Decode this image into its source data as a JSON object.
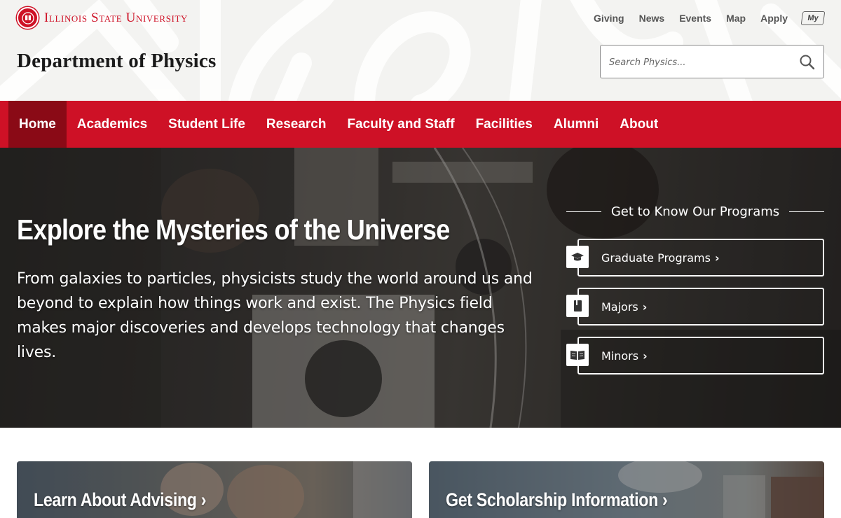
{
  "brand": {
    "university": "Illinois State University",
    "department": "Department of Physics",
    "accent_color": "#ce1126",
    "seal_icon": "redbird-seal-icon"
  },
  "utility_nav": [
    {
      "label": "Giving"
    },
    {
      "label": "News"
    },
    {
      "label": "Events"
    },
    {
      "label": "Map"
    },
    {
      "label": "Apply"
    }
  ],
  "my_badge": "My",
  "search": {
    "placeholder": "Search Physics...",
    "icon": "search-icon"
  },
  "main_nav": [
    {
      "label": "Home",
      "active": true
    },
    {
      "label": "Academics"
    },
    {
      "label": "Student Life"
    },
    {
      "label": "Research"
    },
    {
      "label": "Faculty and Staff"
    },
    {
      "label": "Facilities"
    },
    {
      "label": "Alumni"
    },
    {
      "label": "About"
    }
  ],
  "hero": {
    "title": "Explore the Mysteries of the Universe",
    "text": "From galaxies to particles, physicists study the world around us and beyond to explain how things work and exist. The Physics field makes major discoveries and develops technology that changes lives.",
    "programs_heading": "Get to Know Our Programs",
    "programs": [
      {
        "label": "Graduate Programs",
        "icon": "graduation-cap-icon"
      },
      {
        "label": "Majors",
        "icon": "book-icon"
      },
      {
        "label": "Minors",
        "icon": "open-book-icon"
      }
    ]
  },
  "cards": [
    {
      "label": "Learn About Advising"
    },
    {
      "label": "Get Scholarship Information"
    }
  ]
}
